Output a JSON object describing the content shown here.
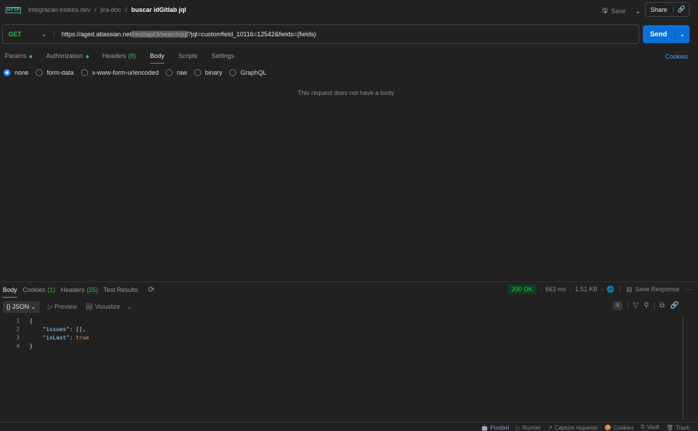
{
  "breadcrumb": {
    "items": [
      "Integracao esteira dev",
      "jira-doc"
    ],
    "current": "buscar idGitlab jql",
    "icon": "http-icon"
  },
  "header": {
    "save_label": "Save",
    "share_label": "Share"
  },
  "request": {
    "method": "GET",
    "url_base": "https://aged.atlassian.net",
    "url_path": "/rest/api/3/search/jql",
    "url_query": "?jql=customfield_10116=12542&fields={fields}",
    "send_label": "Send"
  },
  "req_tabs": [
    {
      "label": "Params",
      "dot": true
    },
    {
      "label": "Authorization",
      "dot": true
    },
    {
      "label": "Headers",
      "count": "(8)"
    },
    {
      "label": "Body",
      "active": true
    },
    {
      "label": "Scripts"
    },
    {
      "label": "Settings"
    }
  ],
  "cookies_label": "Cookies",
  "body_types": [
    "none",
    "form-data",
    "x-www-form-urlencoded",
    "raw",
    "binary",
    "GraphQL"
  ],
  "no_body_text": "This request does not have a body",
  "resp_tabs": [
    {
      "label": "Body",
      "active": true
    },
    {
      "label": "Cookies",
      "count": "(1)"
    },
    {
      "label": "Headers",
      "count": "(25)"
    },
    {
      "label": "Test Results"
    }
  ],
  "response": {
    "status": "200 OK",
    "time": "663 ms",
    "size": "1.51 KB",
    "save_label": "Save Response",
    "format": "JSON",
    "preview_label": "Preview",
    "visualize_label": "Visualize"
  },
  "code": [
    {
      "n": "1",
      "text": "{"
    },
    {
      "n": "2",
      "key": "\"issues\"",
      "val": "[],"
    },
    {
      "n": "3",
      "key": "\"isLast\"",
      "val": "true",
      "bool": true
    },
    {
      "n": "4",
      "text": "}"
    }
  ],
  "footer": [
    "Postbot",
    "Runner",
    "Capture requests",
    "Cookies",
    "Vault",
    "Trash"
  ]
}
